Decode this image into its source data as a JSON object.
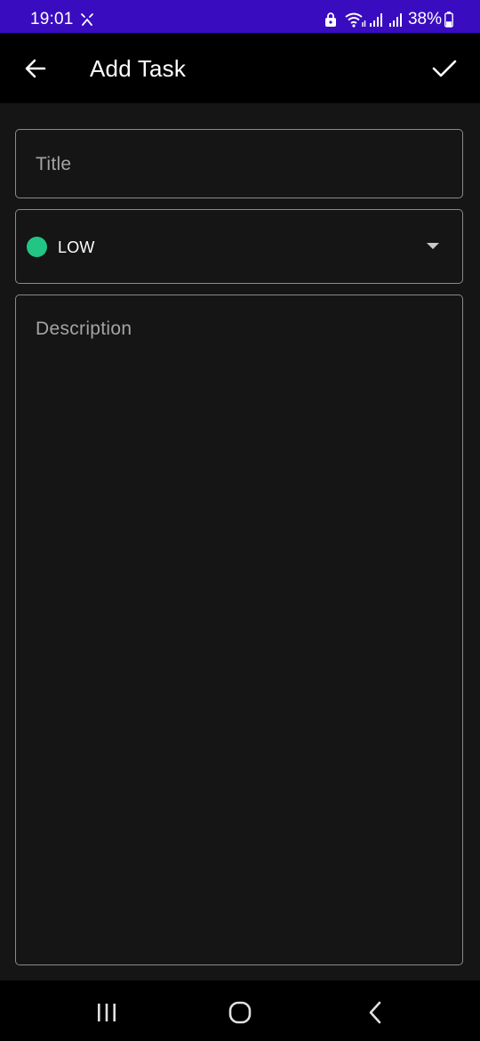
{
  "status_bar": {
    "time": "19:01",
    "battery_percent": "38%",
    "background_color": "#3a0cc0",
    "icons": [
      "alarm-icon",
      "lock-icon",
      "wifi-icon",
      "signal-icon",
      "signal-icon",
      "battery-icon"
    ],
    "battery_level": 0.38
  },
  "app_bar": {
    "title": "Add Task",
    "back_icon": "arrow-left-icon",
    "save_icon": "check-icon"
  },
  "form": {
    "title_placeholder": "Title",
    "priority": {
      "value": "LOW",
      "color": "#22c584"
    },
    "description_placeholder": "Description"
  },
  "nav_bar": {
    "icons": [
      "recents-icon",
      "home-icon",
      "back-icon"
    ]
  }
}
